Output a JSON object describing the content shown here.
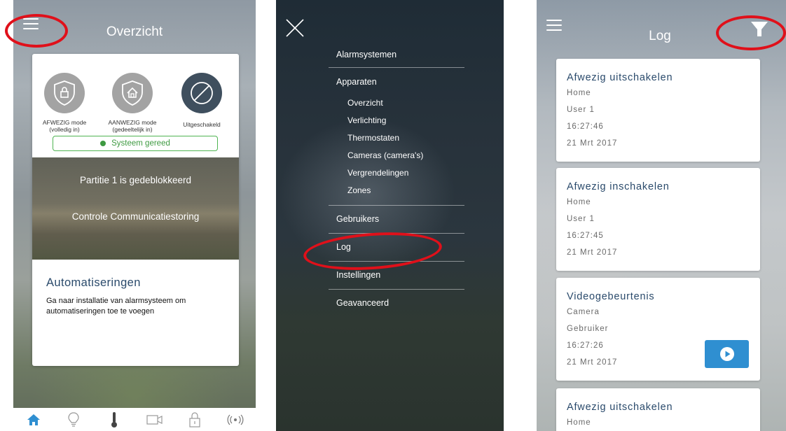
{
  "screen1": {
    "title": "Overzicht",
    "modes": [
      {
        "label": "AFWEZIG mode (volledig in)",
        "icon": "shield-lock-icon"
      },
      {
        "label": "AANWEZIG mode (gedeeltelijk in)",
        "icon": "shield-home-icon"
      },
      {
        "label": "Uitgeschakeld",
        "icon": "disabled-icon"
      }
    ],
    "status": "Systeem gereed",
    "partition_text": "Partitie 1 is gedeblokkeerd",
    "comm_text": "Controle Communicatiestoring",
    "automation_title": "Automatiseringen",
    "automation_desc": "Ga naar installatie van alarmsysteem om automatiseringen toe te voegen",
    "bottom_nav": [
      "home-icon",
      "lightbulb-icon",
      "thermometer-icon",
      "camera-icon",
      "lock-icon",
      "sensor-icon"
    ]
  },
  "screen2": {
    "menu": {
      "alarmsystemen": "Alarmsystemen",
      "apparaten": "Apparaten",
      "sub": [
        "Overzicht",
        "Verlichting",
        "Thermostaten",
        "Cameras (camera's)",
        "Vergrendelingen",
        "Zones"
      ],
      "gebruikers": "Gebruikers",
      "log": "Log",
      "instellingen": "Instellingen",
      "geavanceerd": "Geavanceerd"
    }
  },
  "screen3": {
    "title": "Log",
    "entries": [
      {
        "title": "Afwezig uitschakelen",
        "lines": [
          "Home",
          "User 1",
          "16:27:46",
          "21 Mrt 2017"
        ]
      },
      {
        "title": "Afwezig inschakelen",
        "lines": [
          "Home",
          "User 1",
          "16:27:45",
          "21 Mrt 2017"
        ]
      },
      {
        "title": "Videogebeurtenis",
        "lines": [
          "Camera",
          "Gebruiker",
          "16:27:26",
          "21 Mrt 2017"
        ]
      },
      {
        "title": "Afwezig uitschakelen",
        "lines": [
          "Home"
        ]
      }
    ]
  },
  "colors": {
    "highlight_ring": "#e0101a",
    "status_green": "#3e9a41",
    "heading_blue": "#2a4a6b",
    "play_button": "#2f8fd1",
    "mode_gray": "#a3a3a3",
    "mode_dark": "#3f4f5e"
  }
}
